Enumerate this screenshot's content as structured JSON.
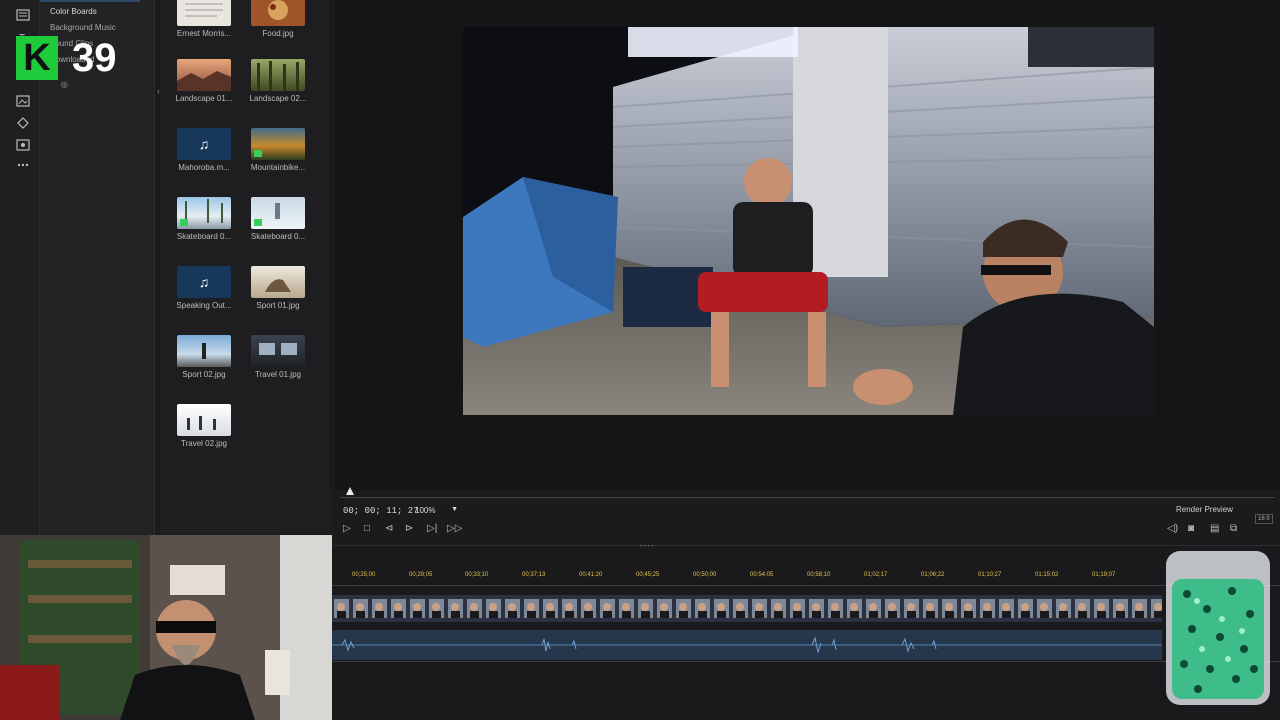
{
  "categories": {
    "items": [
      {
        "label": "Color Boards",
        "active": true
      },
      {
        "label": "Background Music",
        "active": false
      },
      {
        "label": "Sound Clips",
        "active": false
      },
      {
        "label": "Downloaded",
        "active": false
      }
    ]
  },
  "badge": {
    "letter": "K",
    "number": "39"
  },
  "rail_icons": [
    "media-icon",
    "title-icon",
    "transition-icon",
    "fx-icon",
    "overlay-icon",
    "particle-icon",
    "more-icon"
  ],
  "media": [
    {
      "label": "Ernest Morris...",
      "kind": "image",
      "color": "#e9e6df"
    },
    {
      "label": "Food.jpg",
      "kind": "image",
      "color": "#a0542a"
    },
    {
      "label": "Landscape 01...",
      "kind": "image",
      "color": "#b86b4a"
    },
    {
      "label": "Landscape 02...",
      "kind": "image",
      "color": "#5d6a34"
    },
    {
      "label": "Mahoroba.m...",
      "kind": "music",
      "color": "#17385a"
    },
    {
      "label": "Mountainbike...",
      "kind": "video",
      "color": "#c98a2d"
    },
    {
      "label": "Skateboard 0...",
      "kind": "video",
      "color": "#6d8fae"
    },
    {
      "label": "Skateboard 0...",
      "kind": "video",
      "color": "#9cb6c8"
    },
    {
      "label": "Speaking Out...",
      "kind": "music",
      "color": "#17385a"
    },
    {
      "label": "Sport 01.jpg",
      "kind": "image",
      "color": "#c8bba6"
    },
    {
      "label": "Sport 02.jpg",
      "kind": "image",
      "color": "#6a8fb5"
    },
    {
      "label": "Travel 01.jpg",
      "kind": "image",
      "color": "#47505a"
    },
    {
      "label": "Travel 02.jpg",
      "kind": "image",
      "color": "#dfe4e8"
    }
  ],
  "transport": {
    "timecode": "00; 00; 11; 27",
    "zoom": "100%",
    "render_label": "Render Preview",
    "aspect": "16:9"
  },
  "timeline": {
    "ticks": [
      "00;25;00",
      "00;29;05",
      "00;33;10",
      "00;37;13",
      "00;41;20",
      "00;45;25",
      "00;50;00",
      "00;54;05",
      "00;58;10",
      "01;02;17",
      "01;06;22",
      "01;10;27",
      "01;15;02",
      "01;19;07"
    ]
  },
  "colors": {
    "accent": "#2f4a6b",
    "tick": "#e2c24a",
    "badge": "#1fcb3a"
  }
}
